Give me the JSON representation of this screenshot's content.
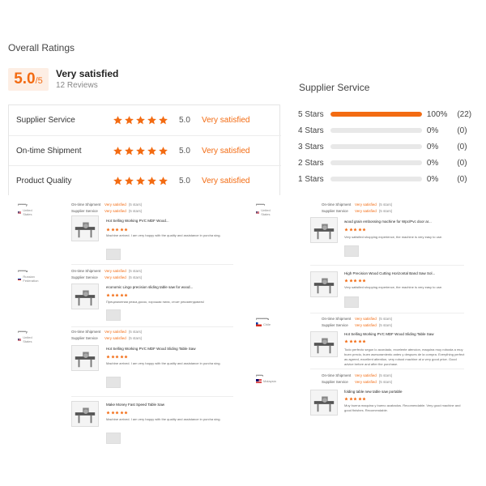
{
  "overall": {
    "title": "Overall Ratings",
    "score": "5.0",
    "score_suffix": "/5",
    "satisfaction": "Very satisfied",
    "reviews": "12 Reviews",
    "accent_color": "#f36b12"
  },
  "ratings": [
    {
      "label": "Supplier Service",
      "stars": 5,
      "score": "5.0",
      "sat": "Very satisfied"
    },
    {
      "label": "On-time Shipment",
      "stars": 5,
      "score": "5.0",
      "sat": "Very satisfied"
    },
    {
      "label": "Product Quality",
      "stars": 5,
      "score": "5.0",
      "sat": "Very satisfied"
    }
  ],
  "supplier": {
    "title": "Supplier Service",
    "rows": [
      {
        "label": "5 Stars",
        "fraction": 1.0,
        "pct": "100%",
        "count": "(22)"
      },
      {
        "label": "4 Stars",
        "fraction": 0,
        "pct": "0%",
        "count": "(0)"
      },
      {
        "label": "3 Stars",
        "fraction": 0,
        "pct": "0%",
        "count": "(0)"
      },
      {
        "label": "2 Stars",
        "fraction": 0,
        "pct": "0%",
        "count": "(0)"
      },
      {
        "label": "1 Stars",
        "fraction": 0,
        "pct": "0%",
        "count": "(0)"
      }
    ]
  },
  "reviews": {
    "meta_labels": {
      "shipment": "On-time Shipment",
      "service": "Supplier Service",
      "sat": "Very satisfied",
      "stars": "(5 stars)"
    },
    "items": [
      {
        "name": "i*********y",
        "country": "United States",
        "flag": "us",
        "show_meta": true,
        "product": "Hot Selling Working PVC MDF Wood...",
        "text": "Machine arrived. I am very happy with the quality and assistance in purcha sing."
      },
      {
        "name": "i*********a",
        "country": "Russian Federation",
        "flag": "ru",
        "show_meta": true,
        "product": "economic Lingo precision sliding table saw for wood...",
        "text": "Прецизионная резка досок, хорошая пила, стоит рекомендовать!"
      },
      {
        "name": "i*********y",
        "country": "United States",
        "flag": "us",
        "show_meta": true,
        "product": "Hot Selling Working PVC MDF Wood Sliding Table Saw",
        "text": "Machine arrived. I am very happy with the quality and assistance in purcha sing."
      },
      {
        "name": "",
        "country": "",
        "flag": "",
        "show_meta": false,
        "product": "Make Money Fast Speed Table Saw",
        "text": "Machine arrived. I am very happy with the quality and assistance in purcha sing."
      },
      {
        "name": "i*********r",
        "country": "United States",
        "flag": "us",
        "show_meta": true,
        "product": "wood grain embossing machine for Wpc/Pvc door ar...",
        "text": "Very satisfied shopping experience, the machine is very easy to use."
      },
      {
        "name": "",
        "country": "",
        "flag": "",
        "show_meta": false,
        "product": "High Precision Wood Cutting Horizontal Band Saw Sol...",
        "text": "Very satisfied shopping experience, the machine is very easy to use."
      },
      {
        "name": "i*************s",
        "country": "Chile",
        "flag": "cl",
        "show_meta": true,
        "product": "Hot Selling Working PVC MDF Wood Sliding Table Saw",
        "text": "Todo perfecto segun lo acordado, excelente atencion, maquina muy robusta a muy buen precio, buen asesoramiento antes y despues de la compra. Everything perfect as agreed, excellent attention, very robust machine at a very good price. Good advice before and after the purchase."
      },
      {
        "name": "i*******r",
        "country": "Malaysia",
        "flag": "my",
        "show_meta": true,
        "product": "folding table new table saw portable",
        "text": "Muy buena maquina y bueno acabados. Recomendable. Very good machine and good finishes. Recomendable."
      }
    ]
  }
}
